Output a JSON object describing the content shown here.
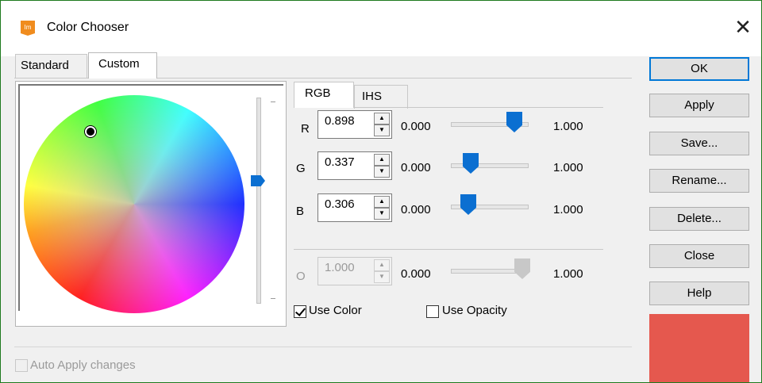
{
  "window": {
    "title": "Color Chooser",
    "app_icon_text": "Im",
    "close_glyph": "✕"
  },
  "tabs": {
    "standard": "Standard",
    "custom": "Custom"
  },
  "model_tabs": {
    "rgb": "RGB",
    "ihs": "IHS"
  },
  "channels": [
    {
      "label": "R",
      "value": "0.898",
      "min": "0.000",
      "max": "1.000",
      "level": 0.898
    },
    {
      "label": "G",
      "value": "0.337",
      "min": "0.000",
      "max": "1.000",
      "level": 0.337
    },
    {
      "label": "B",
      "value": "0.306",
      "min": "0.000",
      "max": "1.000",
      "level": 0.306
    }
  ],
  "opacity": {
    "label": "O",
    "value": "1.000",
    "min": "0.000",
    "max": "1.000",
    "level": 1.0
  },
  "checkboxes": {
    "use_color": {
      "label": "Use Color",
      "checked": true
    },
    "use_opacity": {
      "label": "Use Opacity",
      "checked": false
    },
    "auto_apply": {
      "label": "Auto Apply changes",
      "checked": false
    }
  },
  "buttons": {
    "ok": "OK",
    "apply": "Apply",
    "save": "Save...",
    "rename": "Rename...",
    "delete": "Delete...",
    "close": "Close",
    "help": "Help"
  },
  "colors": {
    "preview": "#e5584e",
    "accent": "#0b6fd1",
    "app_icon": "#f08c1e"
  },
  "icons": {
    "app": "app-logo-icon",
    "close": "close-icon",
    "spin_up": "spin-up-icon",
    "spin_down": "spin-down-icon"
  }
}
